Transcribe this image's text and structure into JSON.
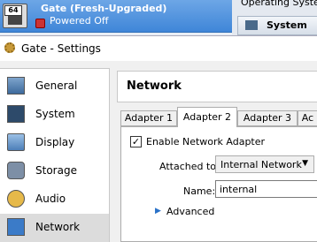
{
  "manager": {
    "vm_name": "Gate (Fresh-Upgraded)",
    "vm_status": "Powered Off",
    "vm_icon_badge": "64",
    "details_os_label": "Operating System:",
    "details_tab": "System"
  },
  "dialog": {
    "title": "Gate - Settings"
  },
  "sidebar": {
    "items": [
      {
        "label": "General",
        "icon": "general-icon"
      },
      {
        "label": "System",
        "icon": "chip-icon"
      },
      {
        "label": "Display",
        "icon": "monitor-icon"
      },
      {
        "label": "Storage",
        "icon": "disk-icon"
      },
      {
        "label": "Audio",
        "icon": "speaker-icon"
      },
      {
        "label": "Network",
        "icon": "network-icon",
        "selected": true
      }
    ]
  },
  "network": {
    "title": "Network",
    "tabs": [
      "Adapter 1",
      "Adapter 2",
      "Adapter 3",
      "Ac"
    ],
    "active_tab": "Adapter 2",
    "enable_label": "Enable Network Adapter",
    "enable_checked": true,
    "checkbox_mark": "✓",
    "attached_label": "Attached to:",
    "attached_value": "Internal Network",
    "name_label": "Name:",
    "name_value": "internal",
    "advanced_label": "Advanced"
  },
  "colors": {
    "selection_blue": "#3f86d8",
    "nav_selected_bg": "#dcdcdc"
  }
}
